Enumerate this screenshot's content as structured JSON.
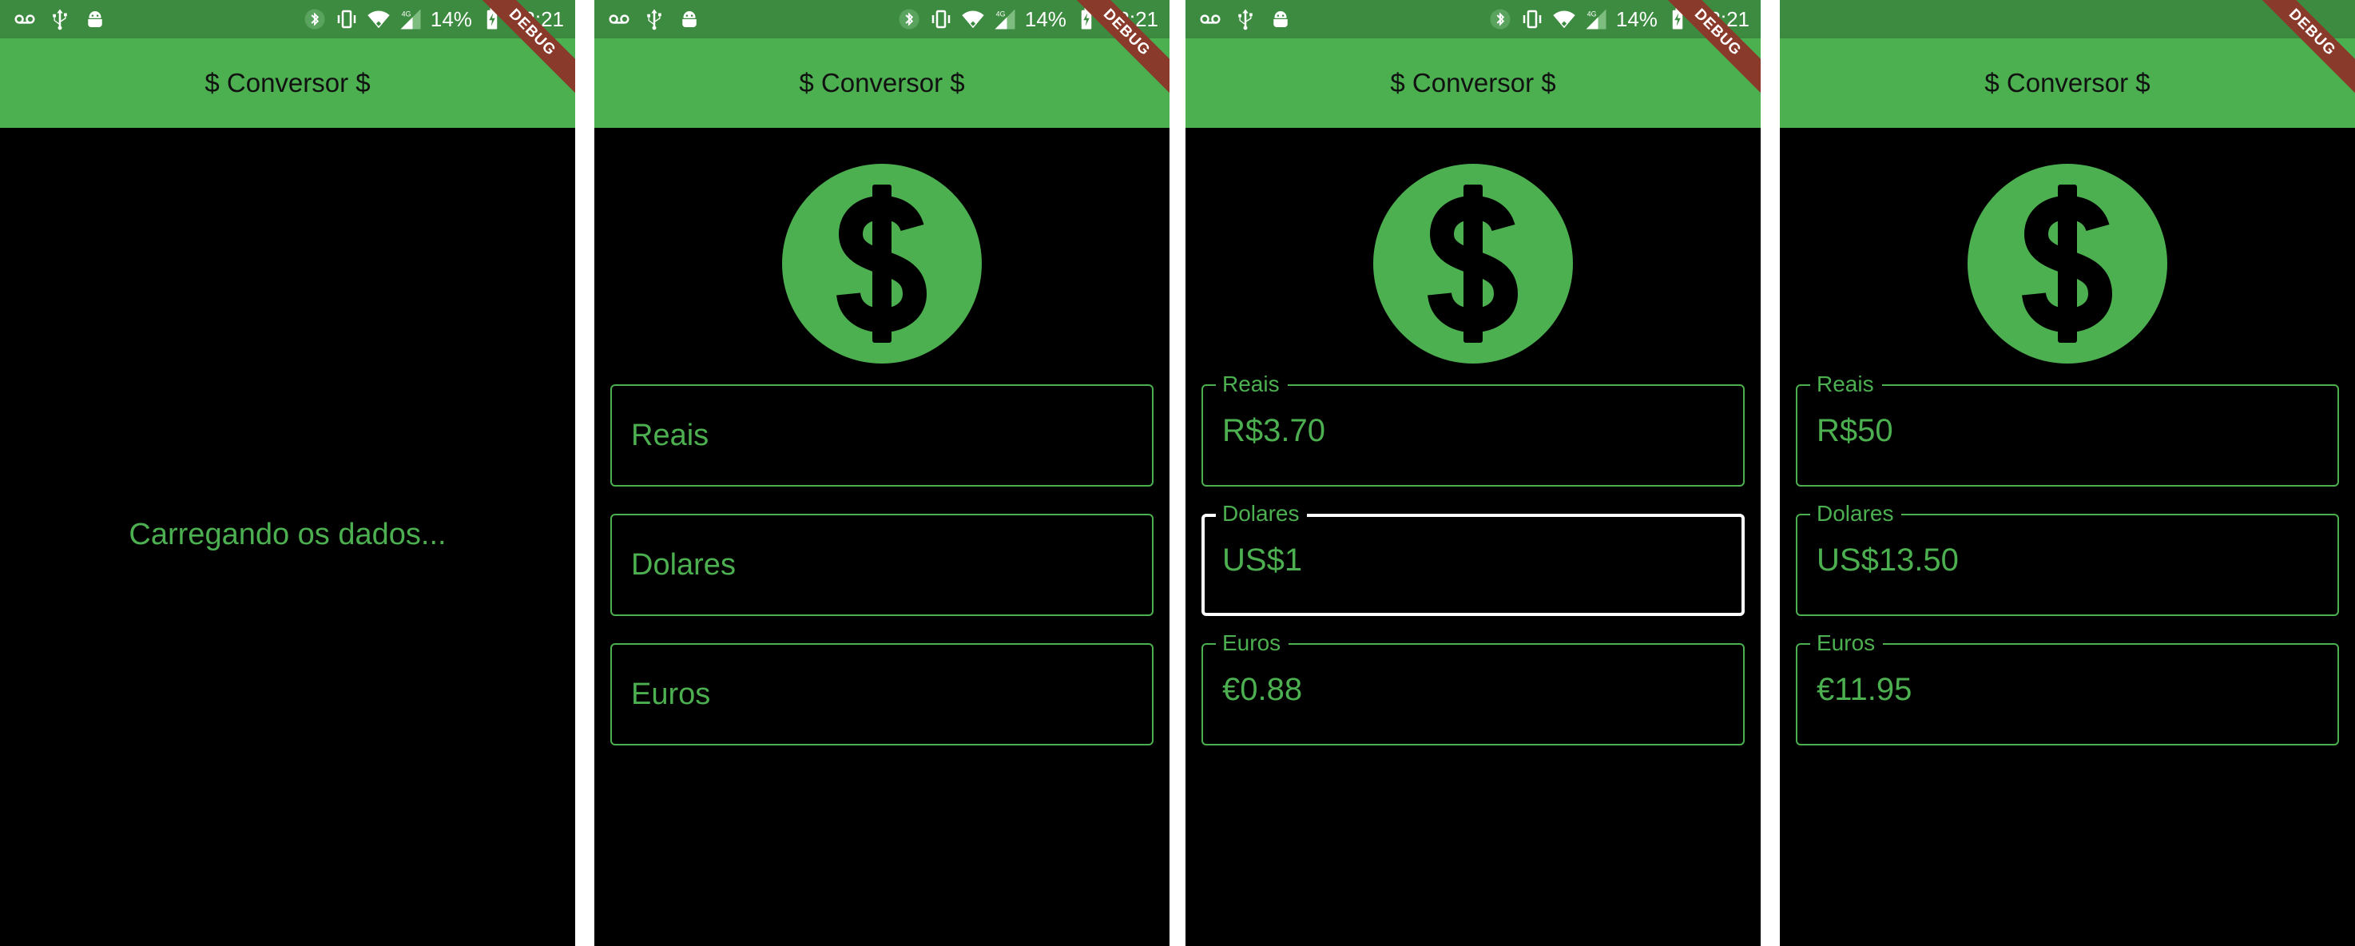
{
  "colors": {
    "primary": "#4caf50",
    "status_bar": "#3d8b40",
    "background": "#000000",
    "focused_border": "#ffffff",
    "debug_banner": "#8a3a2a",
    "app_title_text": "#111111"
  },
  "status_bar": {
    "battery": "14%",
    "time": "22:21",
    "icons_left": [
      "voicemail-icon",
      "usb-icon",
      "android-debug-icon"
    ],
    "icons_right": [
      "bluetooth-icon",
      "vibrate-icon",
      "wifi-icon",
      "signal-4g-icon",
      "battery-charging-icon"
    ]
  },
  "app": {
    "title": "$ Conversor $",
    "debug_label": "DEBUG",
    "coin_icon": "monetization-icon"
  },
  "screens": [
    {
      "state": "loading",
      "loading_text": "Carregando os dados..."
    },
    {
      "state": "empty",
      "fields": [
        {
          "label": "Reais",
          "value": ""
        },
        {
          "label": "Dolares",
          "value": ""
        },
        {
          "label": "Euros",
          "value": ""
        }
      ]
    },
    {
      "state": "dollar-input-focused",
      "fields": [
        {
          "label": "Reais",
          "value": "R$3.70"
        },
        {
          "label": "Dolares",
          "value": "US$1",
          "focused": true
        },
        {
          "label": "Euros",
          "value": "€0.88"
        }
      ]
    },
    {
      "state": "reais-converted",
      "fields": [
        {
          "label": "Reais",
          "value": "R$50"
        },
        {
          "label": "Dolares",
          "value": "US$13.50"
        },
        {
          "label": "Euros",
          "value": "€11.95"
        }
      ]
    }
  ]
}
